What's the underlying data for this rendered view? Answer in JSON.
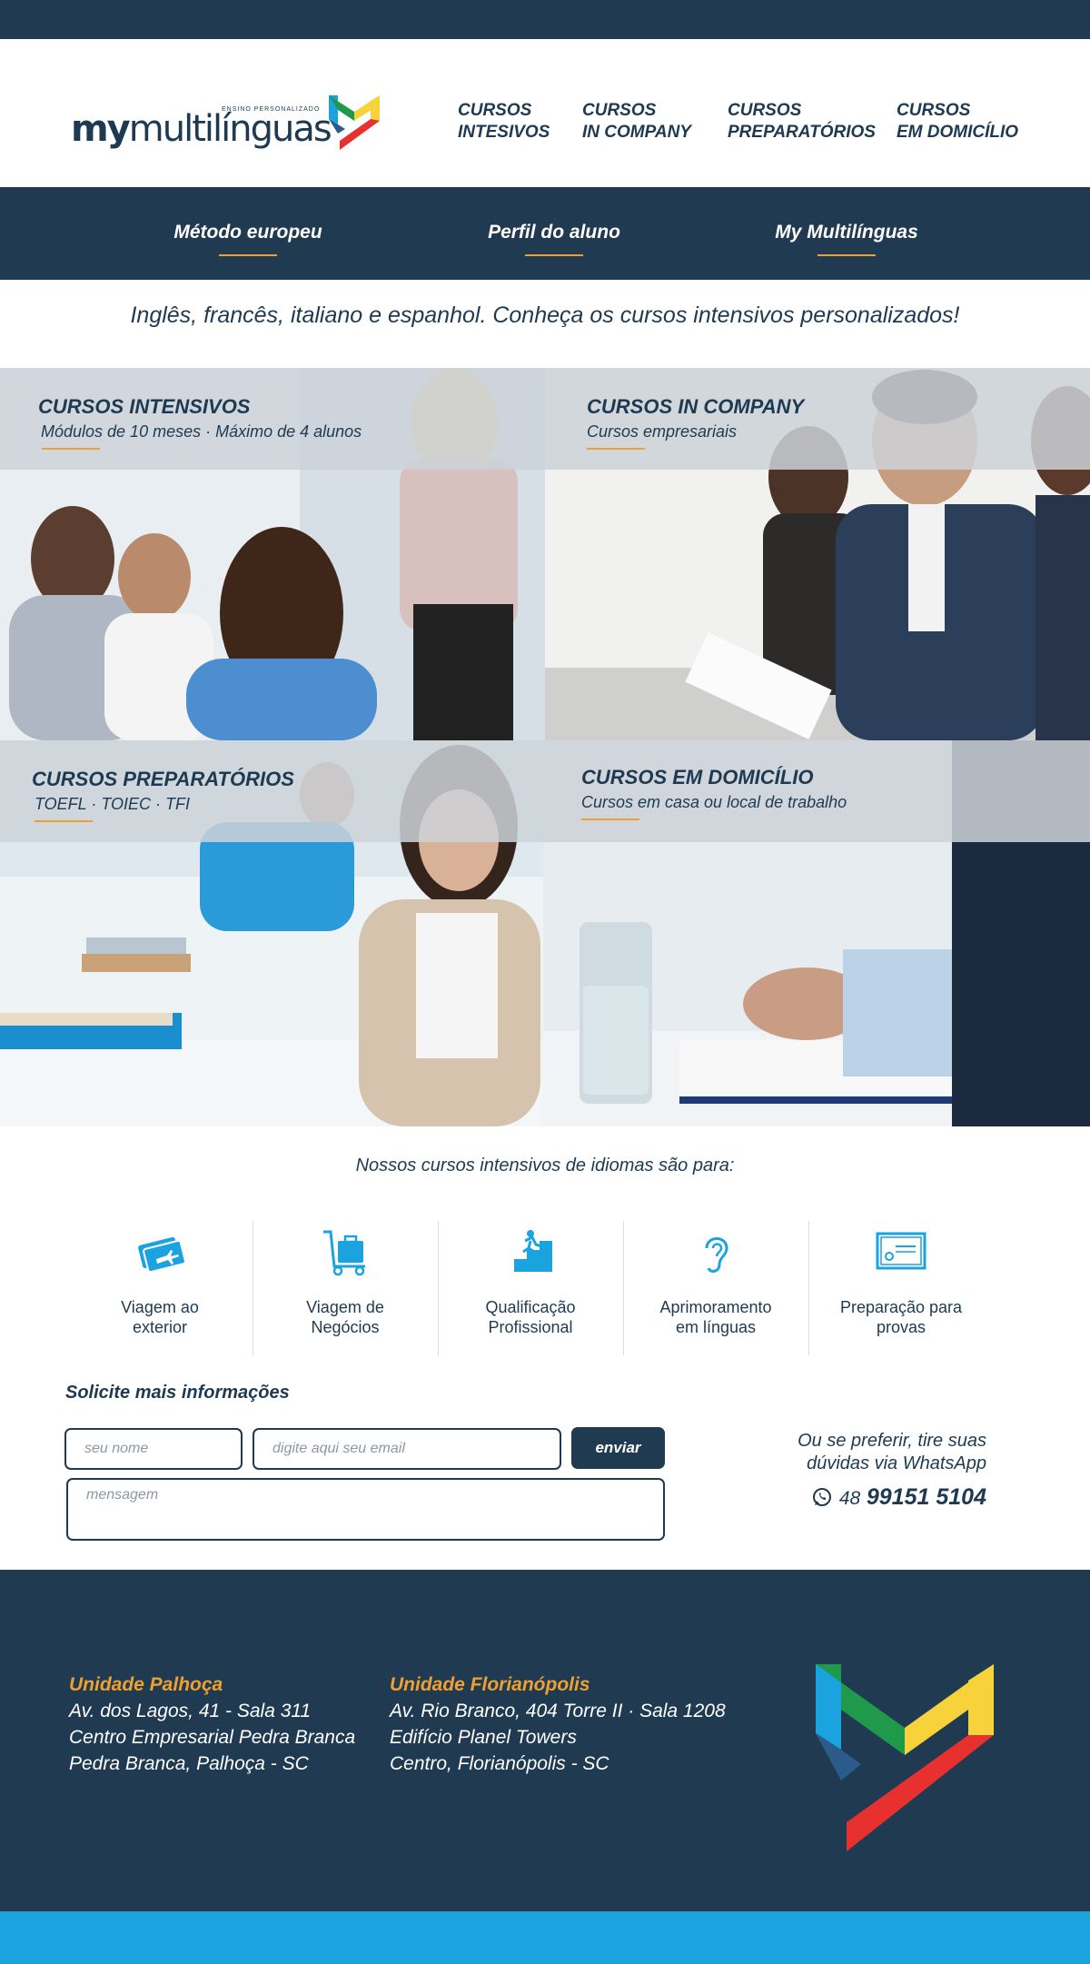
{
  "brand": {
    "name_bold": "my",
    "name_regular": "multilínguas",
    "tagline": "ENSINO PERSONALIZADO"
  },
  "top_nav": [
    {
      "label": "CURSOS\nINTESIVOS"
    },
    {
      "label": "CURSOS\nIN COMPANY"
    },
    {
      "label": "CURSOS\nPREPARATÓRIOS"
    },
    {
      "label": "CURSOS\nEM DOMICÍLIO"
    }
  ],
  "sub_nav": [
    {
      "label": "Método europeu"
    },
    {
      "label": "Perfil do aluno"
    },
    {
      "label": "My Multilínguas"
    }
  ],
  "tagline": "Inglês, francês, italiano e espanhol. Conheça os cursos intensivos personalizados!",
  "courses": [
    {
      "title": "CURSOS INTENSIVOS",
      "subtitle": "Módulos de 10 meses · Máximo de 4 alunos"
    },
    {
      "title": "CURSOS IN COMPANY",
      "subtitle": "Cursos empresariais"
    },
    {
      "title": "CURSOS PREPARATÓRIOS",
      "subtitle": "TOEFL · TOIEC · TFI"
    },
    {
      "title": "CURSOS EM DOMICÍLIO",
      "subtitle": "Cursos em casa ou local de trabalho"
    }
  ],
  "intro": "Nossos cursos intensivos de idiomas são para:",
  "features": [
    {
      "icon": "airplane-ticket-icon",
      "label": "Viagem ao\nexterior"
    },
    {
      "icon": "luggage-cart-icon",
      "label": "Viagem de\nNegócios"
    },
    {
      "icon": "climbing-steps-icon",
      "label": "Qualificação\nProfissional"
    },
    {
      "icon": "ear-icon",
      "label": "Aprimoramento\nem línguas"
    },
    {
      "icon": "certificate-icon",
      "label": "Preparação para\nprovas"
    }
  ],
  "form": {
    "title": "Solicite mais informações",
    "name_placeholder": "seu nome",
    "email_placeholder": "digite aqui seu email",
    "message_placeholder": "mensagem",
    "send_label": "enviar"
  },
  "whatsapp": {
    "text": "Ou se preferir, tire suas\ndúvidas via WhatsApp",
    "area_code": "48",
    "number": "99151 5104"
  },
  "units": [
    {
      "name": "Unidade Palhoça",
      "line1": "Av. dos Lagos, 41 - Sala 311",
      "line2": "Centro Empresarial Pedra Branca",
      "line3": "Pedra Branca, Palhoça - SC"
    },
    {
      "name": "Unidade Florianópolis",
      "line1": "Av. Rio Branco, 404 Torre II · Sala 1208",
      "line2": "Edifício Planel Towers",
      "line3": "Centro, Florianópolis - SC"
    }
  ],
  "colors": {
    "navy": "#1f3a51",
    "orange": "#f0a030",
    "cyan": "#1aa3df",
    "green": "#1f9a4b",
    "yellow": "#f7d23a",
    "red": "#e8302f"
  }
}
